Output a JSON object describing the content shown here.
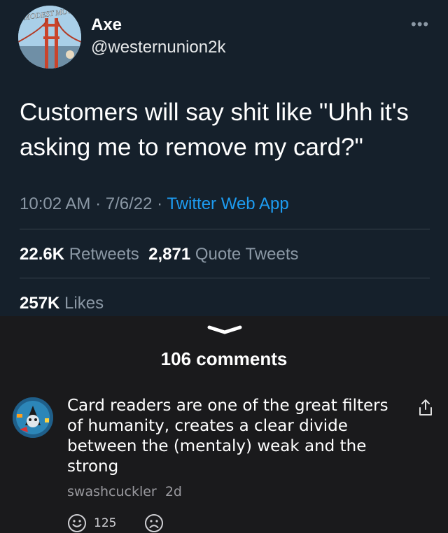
{
  "tweet": {
    "avatar_text": "MODEST MOUSE",
    "display_name": "Axe",
    "handle": "@westernunion2k",
    "more_icon": "ellipsis-icon",
    "text": "Customers will say shit like \"Uhh it's asking me to remove my card?\"",
    "time": "10:02 AM",
    "date": "7/6/22",
    "separator": " · ",
    "source_app": "Twitter Web App",
    "retweets_count": "22.6K",
    "retweets_label": "Retweets",
    "quote_tweets_count": "2,871",
    "quote_tweets_label": "Quote Tweets",
    "likes_count": "257K",
    "likes_label": "Likes"
  },
  "comments_sheet": {
    "title": "106 comments",
    "comment": {
      "text": "Card readers are one of the great filters of humanity, creates a clear divide between the (mentaly) weak and the strong",
      "author": "swashcuckler",
      "age": "2d",
      "upvotes": "125"
    }
  },
  "colors": {
    "tweet_bg": "#15202b",
    "sheet_bg": "#1a1a1c",
    "link_blue": "#1d9bf0",
    "muted_text": "#8b98a5"
  }
}
